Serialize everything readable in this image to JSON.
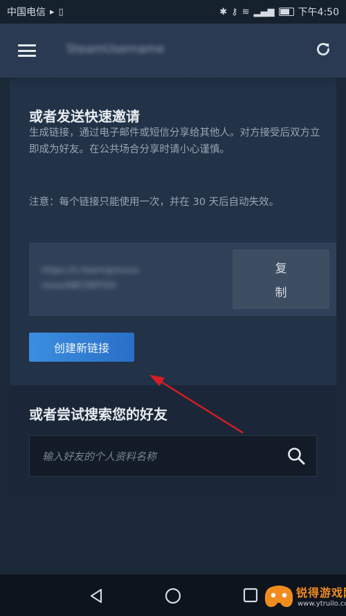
{
  "status_bar": {
    "carrier": "中国电信",
    "time": "下午4:50"
  },
  "app_bar": {
    "title": "SteamUsername"
  },
  "invite": {
    "heading": "或者发送快速邀请",
    "description": "生成链接，通过电子邮件或短信分享给其他人。对方接受后双方立即成为好友。在公共场合分享时请小心谨慎。",
    "note": "注意：每个链接只能使用一次，并在 30 天后自动失效。",
    "link_text": "https://s.team/p/xxxx-xxxx/ABCDEFGH",
    "copy_label_1": "复",
    "copy_label_2": "制",
    "create_button": "创建新链接"
  },
  "search": {
    "heading": "或者尝试搜索您的好友",
    "placeholder": "输入好友的个人资料名称"
  },
  "watermark": {
    "brand": "锐得游戏网",
    "url": "www.ytruilo.com"
  },
  "colors": {
    "background": "#1b2838",
    "app_bar": "#2a3a52",
    "accent_button": "#3b8ee0",
    "annotation_arrow": "#d81c25"
  },
  "icons": [
    "hamburger-menu-icon",
    "refresh-icon",
    "search-icon",
    "back-icon",
    "home-icon",
    "recent-apps-icon"
  ]
}
